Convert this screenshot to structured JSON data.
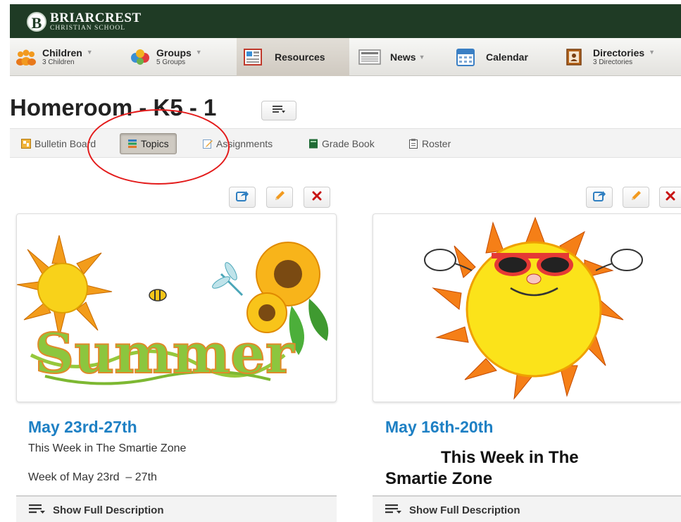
{
  "brand": {
    "name": "BRIARCREST",
    "subtitle": "CHRISTIAN SCHOOL",
    "logo_letter": "B"
  },
  "nav": {
    "items": [
      {
        "label": "Children",
        "sub": "3 Children",
        "icon": "children-icon",
        "caret": true
      },
      {
        "label": "Groups",
        "sub": "5 Groups",
        "icon": "groups-icon",
        "caret": true
      },
      {
        "label": "Resources",
        "sub": "",
        "icon": "resources-icon",
        "caret": false,
        "active": true
      },
      {
        "label": "News",
        "sub": "",
        "icon": "news-icon",
        "caret": true
      },
      {
        "label": "Calendar",
        "sub": "",
        "icon": "calendar-icon",
        "caret": false
      },
      {
        "label": "Directories",
        "sub": "3 Directories",
        "icon": "directories-icon",
        "caret": true
      }
    ],
    "caret_glyph": "▼"
  },
  "page": {
    "title": "Homeroom - K5 - 1"
  },
  "tabs": [
    {
      "label": "Bulletin Board",
      "icon": "bulletin-board-icon"
    },
    {
      "label": "Topics",
      "icon": "topics-icon",
      "active": true
    },
    {
      "label": "Assignments",
      "icon": "assignments-icon"
    },
    {
      "label": "Grade Book",
      "icon": "grade-book-icon"
    },
    {
      "label": "Roster",
      "icon": "roster-icon"
    }
  ],
  "cards": [
    {
      "title": "May 23rd-27th",
      "line1": "This Week in The Smartie Zone",
      "line2": "Week of May 23rd  – 27th",
      "image": "summer-clipart",
      "image_text": "Summer",
      "footer": "Show Full Description"
    },
    {
      "title": "May 16th-20th",
      "heading_line1": "This Week in The",
      "heading_line2": "Smartie Zone",
      "image": "sun-with-sunglasses-clipart",
      "footer": "Show Full Description"
    }
  ],
  "colors": {
    "brand_green": "#1f3b25",
    "link_blue": "#1e80c4",
    "delete_red": "#c81414",
    "edit_orange": "#f29a1f",
    "annotation_red": "#e31b1b"
  }
}
